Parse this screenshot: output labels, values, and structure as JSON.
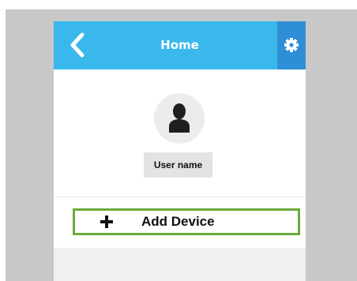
{
  "header": {
    "title": "Home",
    "back_icon": "chevron-left-icon",
    "settings_icon": "gear-icon"
  },
  "profile": {
    "avatar_icon": "user-silhouette-icon",
    "username": "User name"
  },
  "actions": {
    "add_device_label": "Add Device",
    "add_icon": "plus-icon"
  },
  "colors": {
    "header_bg": "#3ab8ec",
    "settings_bg": "#2f8fd6",
    "highlight_border": "#6aaa3a"
  }
}
